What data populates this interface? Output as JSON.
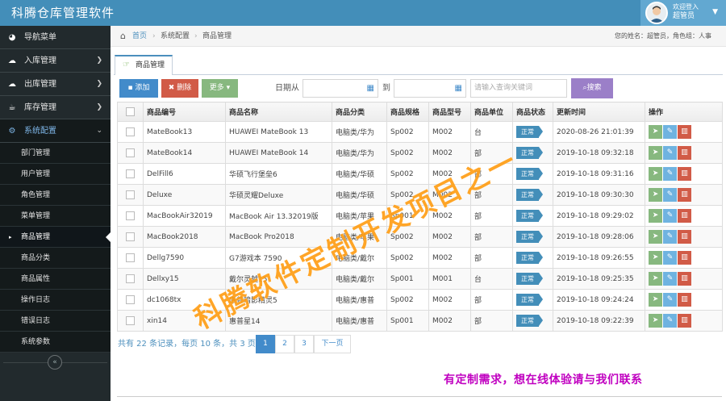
{
  "app": {
    "title": "科腾仓库管理软件"
  },
  "user": {
    "welcome": "欢迎登入",
    "name": "超管员"
  },
  "sidebar": {
    "items": [
      {
        "label": "导航菜单",
        "icon": "tachometer-icon"
      },
      {
        "label": "入库管理",
        "icon": "cloud-download-icon"
      },
      {
        "label": "出库管理",
        "icon": "cloud-upload-icon"
      },
      {
        "label": "库存管理",
        "icon": "coffee-icon"
      },
      {
        "label": "系统配置",
        "icon": "cog-icon"
      }
    ],
    "sub_items": [
      "部门管理",
      "用户管理",
      "角色管理",
      "菜单管理",
      "商品管理",
      "商品分类",
      "商品属性",
      "操作日志",
      "错误日志",
      "系统参数"
    ]
  },
  "breadcrumb": {
    "home": "首页",
    "level2": "系统配置",
    "level3": "商品管理",
    "user_info": "您的姓名：超管员，角色组：人事"
  },
  "tab": {
    "label": "商品管理"
  },
  "toolbar": {
    "add_label": "添加",
    "delete_label": "删除",
    "more_label": "更多",
    "date_from_label": "日期从",
    "date_to_label": "到",
    "search_placeholder": "请输入查询关键词",
    "search_label": "搜索"
  },
  "table": {
    "headers": [
      "商品编号",
      "商品名称",
      "商品分类",
      "商品规格",
      "商品型号",
      "商品单位",
      "商品状态",
      "更新时间",
      "操作"
    ],
    "rows": [
      {
        "code": "MateBook13",
        "name": "HUAWEI MateBook 13",
        "category": "电脑类/华为",
        "spec": "Sp002",
        "model": "M002",
        "unit": "台",
        "status": "正常",
        "updated": "2020-08-26 21:01:39"
      },
      {
        "code": "MateBook14",
        "name": "HUAWEI MateBook 14",
        "category": "电脑类/华为",
        "spec": "Sp002",
        "model": "M002",
        "unit": "部",
        "status": "正常",
        "updated": "2019-10-18 09:32:18"
      },
      {
        "code": "DelFill6",
        "name": "华硕飞行堡垒6",
        "category": "电脑类/华硕",
        "spec": "Sp002",
        "model": "M002",
        "unit": "部",
        "status": "正常",
        "updated": "2019-10-18 09:31:16"
      },
      {
        "code": "Deluxe",
        "name": "华硕灵耀Deluxe",
        "category": "电脑类/华硕",
        "spec": "Sp002",
        "model": "M002",
        "unit": "部",
        "status": "正常",
        "updated": "2019-10-18 09:30:30"
      },
      {
        "code": "MacBookAir32019",
        "name": "MacBook Air 13.32019版",
        "category": "电脑类/苹果",
        "spec": "Sp001",
        "model": "M002",
        "unit": "部",
        "status": "正常",
        "updated": "2019-10-18 09:29:02"
      },
      {
        "code": "MacBook2018",
        "name": "MacBook Pro2018",
        "category": "电脑类/苹果",
        "spec": "Sp002",
        "model": "M002",
        "unit": "部",
        "status": "正常",
        "updated": "2019-10-18 09:28:06"
      },
      {
        "code": "Dellg7590",
        "name": "G7游戏本 7590",
        "category": "电脑类/戴尔",
        "spec": "Sp002",
        "model": "M002",
        "unit": "部",
        "status": "正常",
        "updated": "2019-10-18 09:26:55"
      },
      {
        "code": "Dellxy15",
        "name": "戴尔灵越15",
        "category": "电脑类/戴尔",
        "spec": "Sp001",
        "model": "M001",
        "unit": "台",
        "status": "正常",
        "updated": "2019-10-18 09:25:35"
      },
      {
        "code": "dc1068tx",
        "name": "惠普暗影精灵5",
        "category": "电脑类/惠普",
        "spec": "Sp002",
        "model": "M002",
        "unit": "部",
        "status": "正常",
        "updated": "2019-10-18 09:24:24"
      },
      {
        "code": "xin14",
        "name": "惠普星14",
        "category": "电脑类/惠普",
        "spec": "Sp001",
        "model": "M002",
        "unit": "部",
        "status": "正常",
        "updated": "2019-10-18 09:22:39"
      }
    ]
  },
  "pager": {
    "info": "共有 22 条记录，每页 10 条，共 3 页。",
    "pages": [
      "1",
      "2",
      "3"
    ],
    "next_label": "下一页"
  },
  "watermark": "科腾软件定制开发项目之一",
  "promo": "有定制需求，想在线体验请与我们联系",
  "colors": {
    "navbar": "#438eb9",
    "sidebar": "#222a2d",
    "primary": "#428bca",
    "danger": "#d15b47",
    "success": "#87b87f",
    "purple": "#9b7fc8",
    "watermark": "#ff9e16",
    "promo": "#c000c0"
  }
}
